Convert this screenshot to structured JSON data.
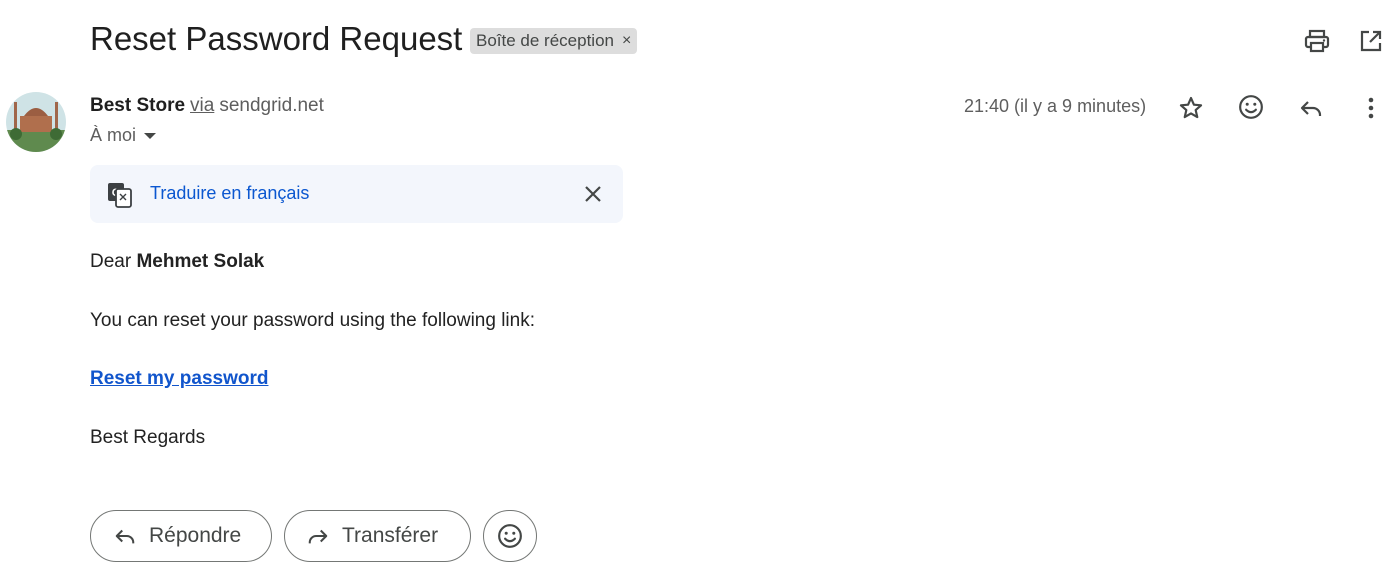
{
  "email": {
    "subject": "Reset Password Request",
    "label_chip": "Boîte de réception",
    "label_chip_close": "×",
    "sender_name": "Best Store",
    "via": "via",
    "sender_domain": "sendgrid.net",
    "recipient": "À moi",
    "timestamp": "21:40 (il y a 9 minutes)"
  },
  "translate": {
    "link_label": "Traduire en français"
  },
  "body": {
    "greeting_prefix": "Dear",
    "greeting_name": "Mehmet Solak",
    "line1": "You can reset your password using the following link:",
    "link_text": "Reset my password",
    "closing": "Best Regards"
  },
  "actions": {
    "reply_label": "Répondre",
    "forward_label": "Transférer"
  },
  "icons": {
    "print": "print-icon",
    "open_new_window": "open-in-new-window-icon",
    "star": "star-icon",
    "emoji": "emoji-icon",
    "reply": "reply-icon",
    "more": "more-vertical-icon",
    "translate": "translate-icon",
    "close": "close-icon",
    "forward": "forward-icon"
  }
}
